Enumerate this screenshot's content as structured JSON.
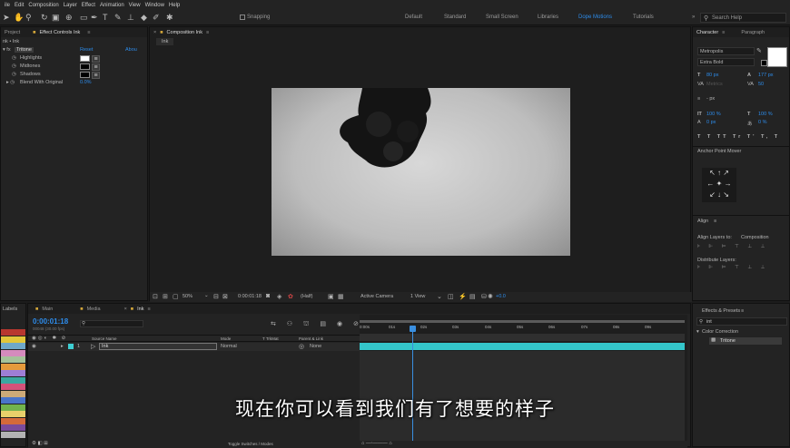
{
  "menu": [
    "ile",
    "Edit",
    "Composition",
    "Layer",
    "Effect",
    "Animation",
    "View",
    "Window",
    "Help"
  ],
  "toolbar": {
    "snapping": "Snapping",
    "workspaces": [
      "Default",
      "Standard",
      "Small Screen",
      "Libraries",
      "Dope Motions",
      "Tutorials"
    ],
    "active_workspace": "Dope Motions",
    "search": "Search Help"
  },
  "project_panel": {
    "tab": "Project",
    "effect_tab": "Effect Controls Ink",
    "path": "nk • Ink",
    "effect_name": "Tritone",
    "reset": "Reset",
    "about": "Abou",
    "params": [
      "Highlights",
      "Midtones",
      "Shadows",
      "Blend With Original"
    ],
    "blend_value": "0.0%"
  },
  "composition": {
    "tab": "Composition Ink",
    "subtab": "Ink",
    "zoom": "50%",
    "timecode": "0:00:01:18",
    "resolution": "(Half)",
    "camera": "Active Camera",
    "view": "1 View",
    "offset": "+0.0"
  },
  "character": {
    "tab": "Character",
    "tab2": "Paragraph",
    "font": "Metropolis",
    "style": "Extra Bold",
    "size": "80 px",
    "leading": "177 px",
    "tracking": "50",
    "stroke": "- px",
    "vscale": "100 %",
    "hscale": "100 %",
    "baseline": "0 px",
    "tsume": "0 %",
    "anchor_title": "Anchor Point Mover",
    "align_title": "Align",
    "align_to_label": "Align Layers to:",
    "align_to": "Composition",
    "distribute_label": "Distribute Layers:"
  },
  "labels_panel": {
    "title": "Labels",
    "colors": [
      "#b8372f",
      "#e2c63a",
      "#6fa8c9",
      "#d58bbd",
      "#a5c29a",
      "#e59a3c",
      "#9e7ed6",
      "#3aa7a1",
      "#d4527a",
      "#cdaa78",
      "#4a74c9",
      "#72b34d",
      "#e8d06b",
      "#d46a3a",
      "#7a4b9b",
      "#b3b3b3"
    ]
  },
  "timeline": {
    "tabs": [
      "Main",
      "Media",
      "Ink"
    ],
    "timecode": "0:00:01:18",
    "frames": "00048 (30.00 fps)",
    "columns": [
      "Source Name",
      "Mode",
      "T TrkMat",
      "Parent & Link"
    ],
    "layer": {
      "num": "1",
      "name": "Ink",
      "mode": "Normal",
      "parent": "None"
    },
    "ruler": [
      "0:00s",
      "01s",
      "02s",
      "03s",
      "04s",
      "05s",
      "06s",
      "07s",
      "08s",
      "09s"
    ],
    "toggle": "Toggle Switches / Modes"
  },
  "effects_presets": {
    "title": "Effects & Presets",
    "search": "int",
    "category": "Color Correction",
    "item": "Tritone"
  },
  "subtitle": "现在你可以看到我们有了想要的样子"
}
